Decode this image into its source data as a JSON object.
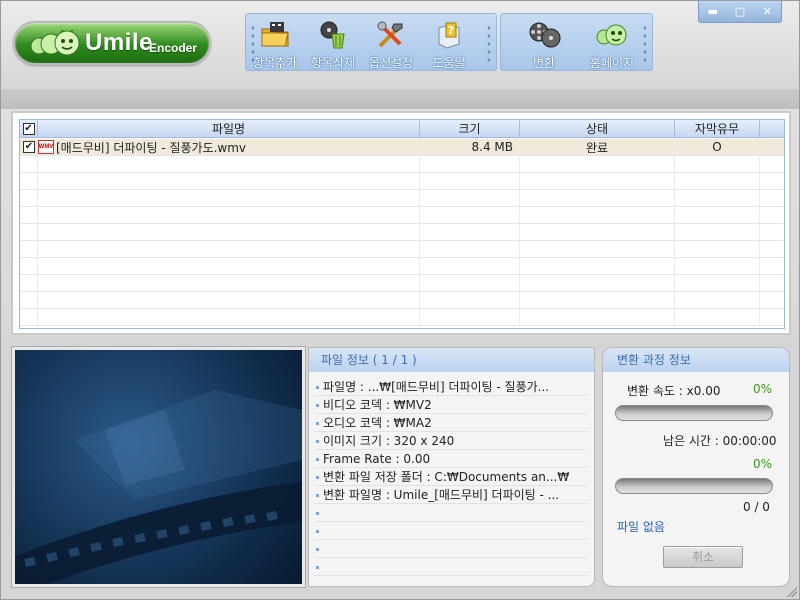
{
  "app": {
    "brand": "Umile",
    "brand_sub": "Encoder"
  },
  "toolbar": {
    "left": [
      {
        "label": "항목추가",
        "icon": "folder-add-icon"
      },
      {
        "label": "항목삭제",
        "icon": "trash-delete-icon"
      },
      {
        "label": "옵션설정",
        "icon": "tools-settings-icon"
      },
      {
        "label": "도움말",
        "icon": "help-icon"
      }
    ],
    "right": [
      {
        "label": "변환",
        "icon": "film-reel-convert-icon"
      },
      {
        "label": "홈페이지",
        "icon": "bug-home-icon"
      }
    ]
  },
  "window_controls": {
    "minimize": "▬",
    "maximize": "□",
    "close": "✕"
  },
  "file_list": {
    "columns": [
      "파일명",
      "크기",
      "상태",
      "자막유무"
    ],
    "rows": [
      {
        "checked": true,
        "type_badge": "WMV",
        "name": "[매드무비] 더파이팅 - 질풍가도.wmv",
        "size": "8.4 MB",
        "status": "완료",
        "subtitle": "O"
      }
    ]
  },
  "file_info": {
    "title": "파일 정보 ( 1 / 1 )",
    "items": [
      "파일명 : ...₩[매드무비] 더파이팅 - 질풍가...",
      "비디오 코덱 : ₩MV2",
      "오디오 코덱 : ₩MA2",
      "이미지 크기 : 320 x 240",
      "Frame Rate : 0.00",
      "변환 파일 저장 폴더 : C:₩Documents an...₩",
      "변환 파일명 : Umile_[매드무비] 더파이팅 - ...",
      "",
      "",
      "",
      ""
    ]
  },
  "conversion": {
    "title": "변환 과정 정보",
    "speed_label": "변환 속도 : x0.00",
    "speed_pct": "0%",
    "speed_progress": 0,
    "remaining_label": "남은 시간 : 00:00:00",
    "total_pct": "0%",
    "total_progress": 0,
    "count": "0 / 0",
    "file_status": "파일 없음",
    "cancel_label": "취소"
  },
  "colors": {
    "accent": "#3b6fb0",
    "toolbar_bg": "#b6cfee",
    "progress_text": "#3a9a1a",
    "logo_green": "#2e8a1e"
  }
}
